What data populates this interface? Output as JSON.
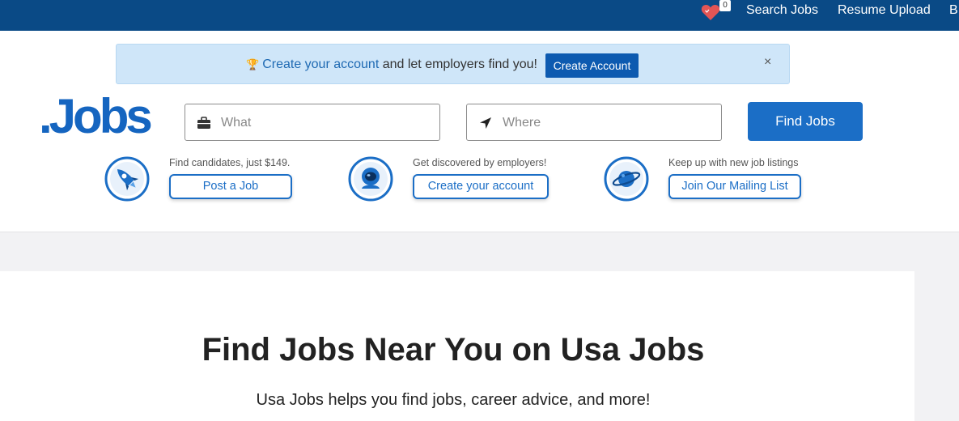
{
  "topbar": {
    "favorites_count": "0",
    "nav": [
      "Search Jobs",
      "Resume Upload",
      "B"
    ]
  },
  "banner": {
    "link_text": "Create your account",
    "text_rest": " and let employers find you!",
    "button_label": "Create Account",
    "close": "×"
  },
  "logo": ".Jobs",
  "search": {
    "what_placeholder": "What",
    "where_placeholder": "Where",
    "find_label": "Find Jobs"
  },
  "promos": [
    {
      "icon": "rocket-icon",
      "caption": "Find candidates, just $149.",
      "button": "Post a Job"
    },
    {
      "icon": "astronaut-icon",
      "caption": "Get discovered by employers!",
      "button": "Create your account"
    },
    {
      "icon": "planet-icon",
      "caption": "Keep up with new job listings",
      "button": "Join Our Mailing List"
    }
  ],
  "hero": {
    "title": "Find Jobs Near You on Usa Jobs",
    "subtitle": "Usa Jobs helps you find jobs, career advice, and more!"
  },
  "colors": {
    "topbar": "#0a4a86",
    "accent": "#1b6ec6",
    "banner_bg": "#cfe6f9",
    "heart": "#e25555"
  }
}
